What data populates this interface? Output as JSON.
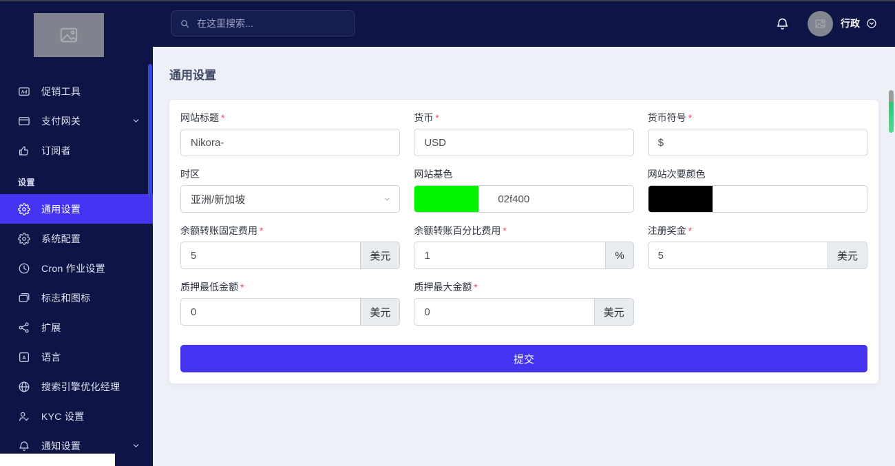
{
  "topbar": {
    "search_placeholder": "在这里搜索...",
    "user_name": "行政"
  },
  "sidebar": {
    "section_label": "设置",
    "items_top": [
      {
        "name": "promotion-tools",
        "label": "促销工具",
        "icon": "ad-icon"
      },
      {
        "name": "payment-gateways",
        "label": "支付网关",
        "icon": "credit-card-icon",
        "chevron": true
      },
      {
        "name": "subscribers",
        "label": "订阅者",
        "icon": "thumbs-up-icon"
      }
    ],
    "items_settings": [
      {
        "name": "general-setting",
        "label": "通用设置",
        "icon": "cog-icon",
        "active": true
      },
      {
        "name": "system-configuration",
        "label": "系统配置",
        "icon": "gear-icon"
      },
      {
        "name": "cron-job-setting",
        "label": "Cron 作业设置",
        "icon": "clock-icon"
      },
      {
        "name": "logo-and-favicon",
        "label": "标志和图标",
        "icon": "images-icon"
      },
      {
        "name": "extensions",
        "label": "扩展",
        "icon": "share-nodes-icon"
      },
      {
        "name": "language",
        "label": "语言",
        "icon": "language-icon"
      },
      {
        "name": "seo-manager",
        "label": "搜索引擎优化经理",
        "icon": "globe-icon"
      },
      {
        "name": "kyc-setting",
        "label": "KYC 设置",
        "icon": "user-check-icon"
      },
      {
        "name": "notification-setting",
        "label": "通知设置",
        "icon": "bell-icon",
        "chevron": true
      }
    ]
  },
  "page": {
    "title": "通用设置"
  },
  "form": {
    "fields": [
      {
        "name": "site-title",
        "label": "网站标题",
        "required": true,
        "type": "text",
        "value": "Nikora-"
      },
      {
        "name": "currency",
        "label": "货币",
        "required": true,
        "type": "text",
        "value": "USD"
      },
      {
        "name": "currency-symbol",
        "label": "货币符号",
        "required": true,
        "type": "text",
        "value": "$"
      },
      {
        "name": "timezone",
        "label": "时区",
        "required": false,
        "type": "select",
        "value": "亚洲/新加坡"
      },
      {
        "name": "site-base-color",
        "label": "网站基色",
        "required": false,
        "type": "color",
        "value": "02f400",
        "swatch": "#02f400"
      },
      {
        "name": "site-secondary-color",
        "label": "网站次要颜色",
        "required": false,
        "type": "color",
        "value": "",
        "swatch": "#000000"
      },
      {
        "name": "balance-transfer-fixed-charge",
        "label": "余额转账固定费用",
        "required": true,
        "type": "addon",
        "value": "5",
        "addon": "美元"
      },
      {
        "name": "balance-transfer-percent-charge",
        "label": "余额转账百分比费用",
        "required": true,
        "type": "addon",
        "value": "1",
        "addon": "%"
      },
      {
        "name": "signup-bonus",
        "label": "注册奖金",
        "required": true,
        "type": "addon",
        "value": "5",
        "addon": "美元"
      },
      {
        "name": "min-stake-amount",
        "label": "质押最低金额",
        "required": true,
        "type": "addon",
        "value": "0",
        "addon": "美元"
      },
      {
        "name": "max-stake-amount",
        "label": "质押最大金额",
        "required": true,
        "type": "addon",
        "value": "0",
        "addon": "美元"
      }
    ],
    "submit_label": "提交"
  },
  "colors": {
    "accent": "#4433f0",
    "site_base_color": "#02f400",
    "site_secondary_color": "#000000",
    "scrollbar_green": "#2fd06e"
  }
}
